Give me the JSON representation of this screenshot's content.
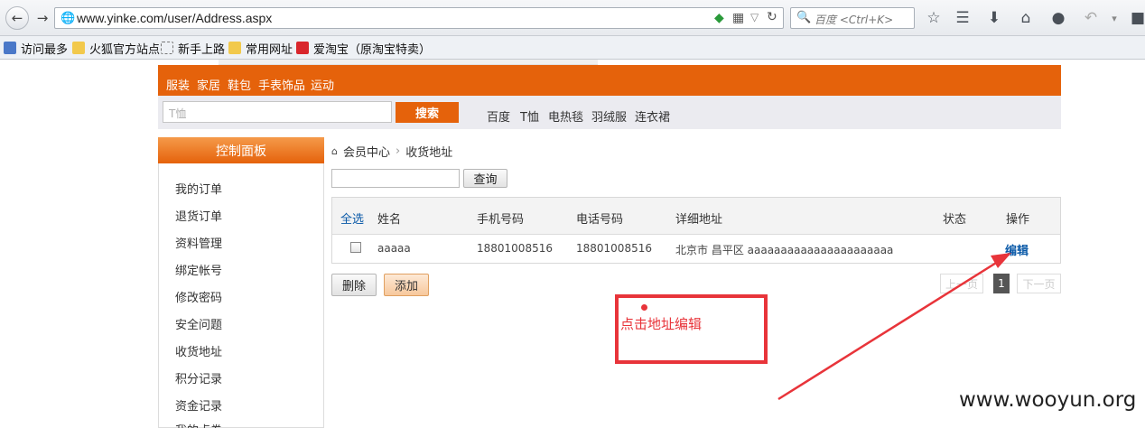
{
  "browser": {
    "url": "www.yinke.com/user/Address.aspx",
    "search_placeholder": "百度 <Ctrl+K>",
    "bookmarks": [
      "访问最多",
      "火狐官方站点",
      "新手上路",
      "常用网址",
      "爱淘宝（原淘宝特卖）"
    ]
  },
  "site": {
    "categories": [
      "服装",
      "家居",
      "鞋包",
      "手表饰品",
      "运动"
    ],
    "search_placeholder": "T恤",
    "search_button": "搜索",
    "hot_words": [
      "百度",
      "T恤",
      "电热毯",
      "羽绒服",
      "连衣裙"
    ]
  },
  "sidebar": {
    "title": "控制面板",
    "items": [
      "我的订单",
      "退货订单",
      "资料管理",
      "绑定帐号",
      "修改密码",
      "安全问题",
      "收货地址",
      "积分记录",
      "资金记录",
      "我的点券"
    ]
  },
  "breadcrumb": {
    "home": "会员中心",
    "current": "收货地址"
  },
  "query": {
    "button": "查询"
  },
  "table": {
    "headers": {
      "select_all": "全选",
      "name": "姓名",
      "mobile": "手机号码",
      "phone": "电话号码",
      "address": "详细地址",
      "status": "状态",
      "action": "操作"
    },
    "rows": [
      {
        "name": "aaaaa",
        "mobile": "18801008516",
        "phone": "18801008516",
        "address": "北京市 昌平区 aaaaaaaaaaaaaaaaaaaaaa",
        "status": "",
        "action": "编辑"
      }
    ]
  },
  "buttons": {
    "delete": "删除",
    "add": "添加"
  },
  "pagination": {
    "prev": "上一页",
    "current": "1",
    "next": "下一页"
  },
  "annotation": {
    "text": "点击地址编辑",
    "color": "#e8343a"
  },
  "watermark": "www.wooyun.org",
  "colors": {
    "brand_orange": "#e5620b",
    "link_blue": "#0b5aa8"
  }
}
